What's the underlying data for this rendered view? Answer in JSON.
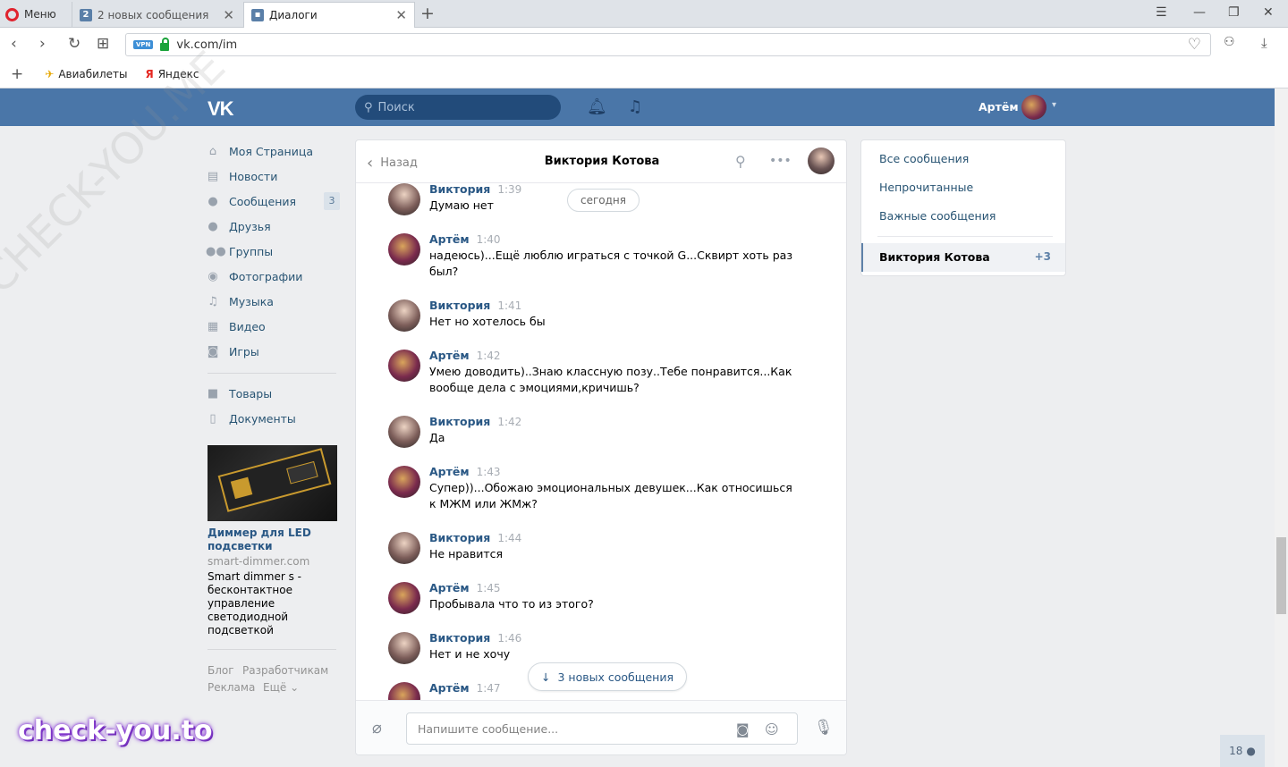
{
  "browser": {
    "menu_label": "Меню",
    "tabs": [
      {
        "label": "2 новых сообщения",
        "favicon": "2"
      },
      {
        "label": "Диалоги"
      }
    ],
    "url": "vk.com/im",
    "vpn_label": "VPN",
    "bookmarks": [
      {
        "label": "Авиабилеты",
        "icon": "plane-icon"
      },
      {
        "label": "Яндекс",
        "icon": "yandex-icon"
      }
    ]
  },
  "header": {
    "logo": "VK",
    "search_placeholder": "Поиск",
    "user_name": "Артём"
  },
  "sidebar": {
    "items": [
      {
        "label": "Моя Страница",
        "icon": "home-icon"
      },
      {
        "label": "Новости",
        "icon": "news-icon"
      },
      {
        "label": "Сообщения",
        "icon": "messages-icon",
        "badge": "3"
      },
      {
        "label": "Друзья",
        "icon": "friend-icon"
      },
      {
        "label": "Группы",
        "icon": "groups-icon"
      },
      {
        "label": "Фотографии",
        "icon": "camera-icon"
      },
      {
        "label": "Музыка",
        "icon": "music-icon"
      },
      {
        "label": "Видео",
        "icon": "video-icon"
      },
      {
        "label": "Игры",
        "icon": "gamepad-icon"
      }
    ],
    "items2": [
      {
        "label": "Товары",
        "icon": "bag-icon"
      },
      {
        "label": "Документы",
        "icon": "document-icon"
      }
    ],
    "ad": {
      "title": "Диммер для LED подсветки",
      "domain": "smart-dimmer.com",
      "description": "Smart dimmer s - бесконтактное управление светодиодной подсветкой"
    },
    "footer": [
      "Блог",
      "Разработчикам",
      "Реклама",
      "Ещё ⌄"
    ]
  },
  "chat": {
    "back_label": "Назад",
    "title": "Виктория Котова",
    "today_label": "сегодня",
    "new_messages_label": "3 новых сообщения",
    "input_placeholder": "Напишите сообщение...",
    "messages": [
      {
        "author": "Виктория",
        "time": "1:39",
        "text": "Думаю нет",
        "who": "v"
      },
      {
        "author": "Артём",
        "time": "1:40",
        "text": "надеюсь)...Ещё люблю играться с точкой G...Сквирт хоть раз был?",
        "who": "a"
      },
      {
        "author": "Виктория",
        "time": "1:41",
        "text": "Нет но хотелось бы",
        "who": "v"
      },
      {
        "author": "Артём",
        "time": "1:42",
        "text": "Умею доводить)..Знаю классную позу..Тебе понравится...Как вообще дела с эмоциями,кричишь?",
        "who": "a"
      },
      {
        "author": "Виктория",
        "time": "1:42",
        "text": "Да",
        "who": "v"
      },
      {
        "author": "Артём",
        "time": "1:43",
        "text": "Супер))...Обожаю эмоциональных девушек...Как относишься к МЖМ или ЖМж?",
        "who": "a"
      },
      {
        "author": "Виктория",
        "time": "1:44",
        "text": "Не нравится",
        "who": "v"
      },
      {
        "author": "Артём",
        "time": "1:45",
        "text": "Пробывала что то из этого?",
        "who": "a"
      },
      {
        "author": "Виктория",
        "time": "1:46",
        "text": "Нет и не хочу",
        "who": "v"
      },
      {
        "author": "Артём",
        "time": "1:47",
        "text": "",
        "who": "a"
      }
    ]
  },
  "right_panel": {
    "items": [
      "Все сообщения",
      "Непрочитанные",
      "Важные сообщения"
    ],
    "selected_name": "Виктория Котова",
    "selected_count": "+3"
  },
  "online_count": "18",
  "watermarks": [
    "check-you.to",
    "CHECK-YOU.ME"
  ]
}
